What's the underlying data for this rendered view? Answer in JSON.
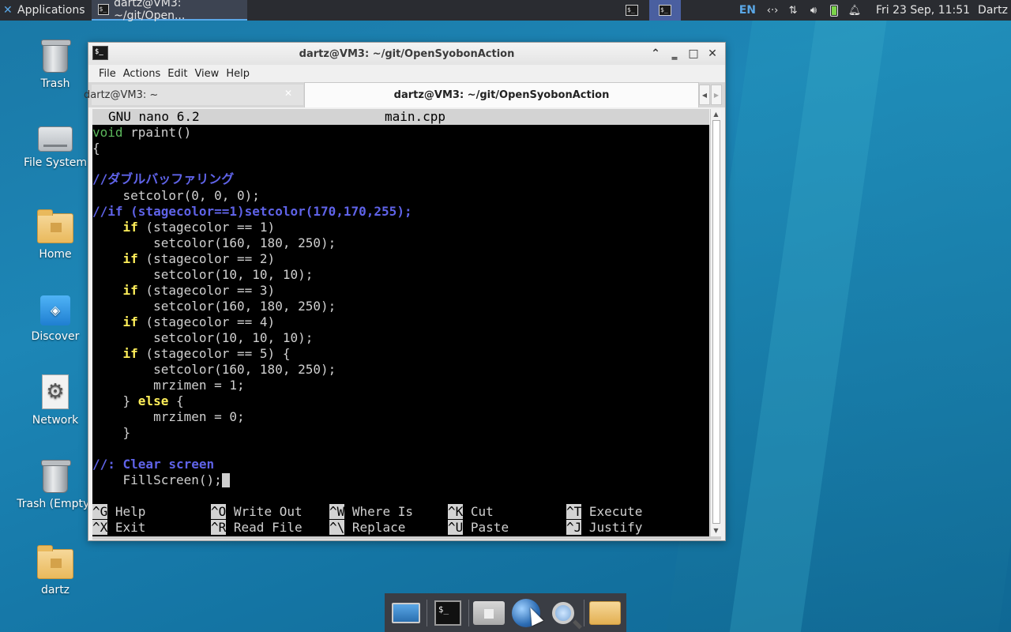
{
  "top_panel": {
    "applications_label": "Applications",
    "task_label": "dartz@VM3: ~/git/Open...",
    "lang": "EN",
    "clock": "Fri 23 Sep, 11:51",
    "user": "Dartz"
  },
  "desktop_icons": [
    {
      "label": "Trash"
    },
    {
      "label": "File System"
    },
    {
      "label": "Home"
    },
    {
      "label": "Discover"
    },
    {
      "label": "Network"
    },
    {
      "label": "Trash (Empty)"
    },
    {
      "label": "dartz"
    }
  ],
  "window": {
    "title": "dartz@VM3: ~/git/OpenSyobonAction",
    "menu": [
      "File",
      "Actions",
      "Edit",
      "View",
      "Help"
    ],
    "tabs": [
      {
        "label": "dartz@VM3: ~",
        "active": false
      },
      {
        "label": "dartz@VM3: ~/git/OpenSyobonAction",
        "active": true
      }
    ]
  },
  "nano": {
    "version": "GNU nano 6.2",
    "filename": "main.cpp",
    "shortcuts": [
      [
        {
          "key": "^G",
          "label": "Help"
        },
        {
          "key": "^O",
          "label": "Write Out"
        },
        {
          "key": "^W",
          "label": "Where Is"
        },
        {
          "key": "^K",
          "label": "Cut"
        },
        {
          "key": "^T",
          "label": "Execute"
        }
      ],
      [
        {
          "key": "^X",
          "label": "Exit"
        },
        {
          "key": "^R",
          "label": "Read File"
        },
        {
          "key": "^\\",
          "label": "Replace"
        },
        {
          "key": "^U",
          "label": "Paste"
        },
        {
          "key": "^J",
          "label": "Justify"
        }
      ]
    ]
  },
  "code": {
    "l1_type": "void",
    "l1_rest": " rpaint()",
    "l2": "{",
    "l4": "//ダブルバッファリング",
    "l5": "    setcolor(0, 0, 0);",
    "l6": "//if (stagecolor==1)setcolor(170,170,255);",
    "if_kw": "if",
    "else_kw": "else",
    "l7_rest": " (stagecolor == 1)",
    "l8": "        setcolor(160, 180, 250);",
    "l9_rest": " (stagecolor == 2)",
    "l10": "        setcolor(10, 10, 10);",
    "l11_rest": " (stagecolor == 3)",
    "l12": "        setcolor(160, 180, 250);",
    "l13_rest": " (stagecolor == 4)",
    "l14": "        setcolor(10, 10, 10);",
    "l15_rest": " (stagecolor == 5) {",
    "l16": "        setcolor(160, 180, 250);",
    "l17": "        mrzimen = 1;",
    "l18_pre": "    } ",
    "l18_post": " {",
    "l19": "        mrzimen = 0;",
    "l20": "    }",
    "l22": "//: Clear screen",
    "l23": "    FillScreen();"
  },
  "colors": {
    "keyword": "#ffef5a",
    "type": "#5cb85c",
    "comment": "#5f63e8",
    "terminal_bg": "#000000"
  }
}
